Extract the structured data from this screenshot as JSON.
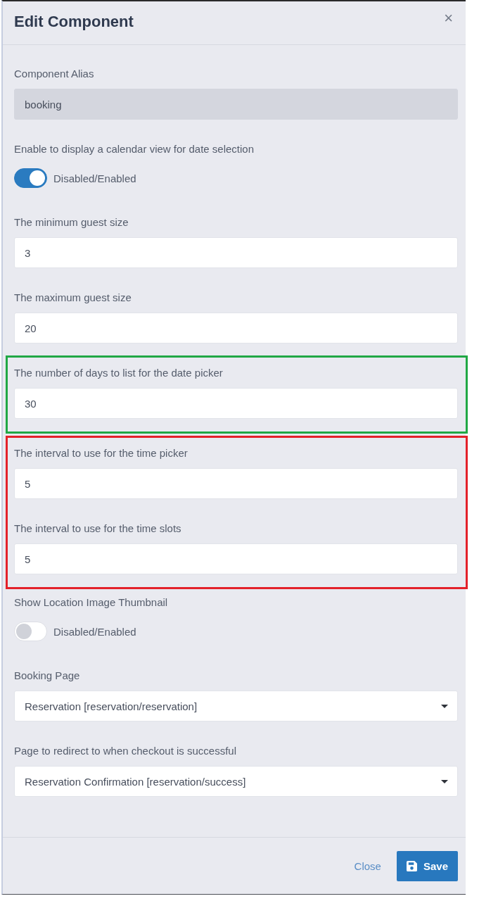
{
  "modal": {
    "title": "Edit Component",
    "close_label": "×"
  },
  "form": [
    {
      "kind": "text",
      "label": "Component Alias",
      "value": "booking",
      "disabled": true
    },
    {
      "kind": "toggle",
      "label": "Enable to display a calendar view for date selection",
      "caption": "Disabled/Enabled",
      "on": true
    },
    {
      "kind": "text",
      "label": "The minimum guest size",
      "value": "3",
      "disabled": false
    },
    {
      "kind": "text",
      "label": "The maximum guest size",
      "value": "20",
      "disabled": false
    },
    {
      "kind": "highlight",
      "color": "#21a845",
      "children": [
        {
          "kind": "text",
          "label": "The number of days to list for the date picker",
          "value": "30",
          "disabled": false
        }
      ]
    },
    {
      "kind": "highlight",
      "color": "#e3212a",
      "children": [
        {
          "kind": "text",
          "label": "The interval to use for the time picker",
          "value": "5",
          "disabled": false
        },
        {
          "kind": "text",
          "label": "The interval to use for the time slots",
          "value": "5",
          "disabled": false
        }
      ]
    },
    {
      "kind": "toggle",
      "label": "Show Location Image Thumbnail",
      "caption": "Disabled/Enabled",
      "on": false
    },
    {
      "kind": "select",
      "label": "Booking Page",
      "value": "Reservation [reservation/reservation]"
    },
    {
      "kind": "select",
      "label": "Page to redirect to when checkout is successful",
      "value": "Reservation Confirmation [reservation/success]"
    }
  ],
  "footer": {
    "buttons": [
      {
        "kind": "link",
        "label": "Close"
      },
      {
        "kind": "primary",
        "label": "Save"
      }
    ]
  }
}
